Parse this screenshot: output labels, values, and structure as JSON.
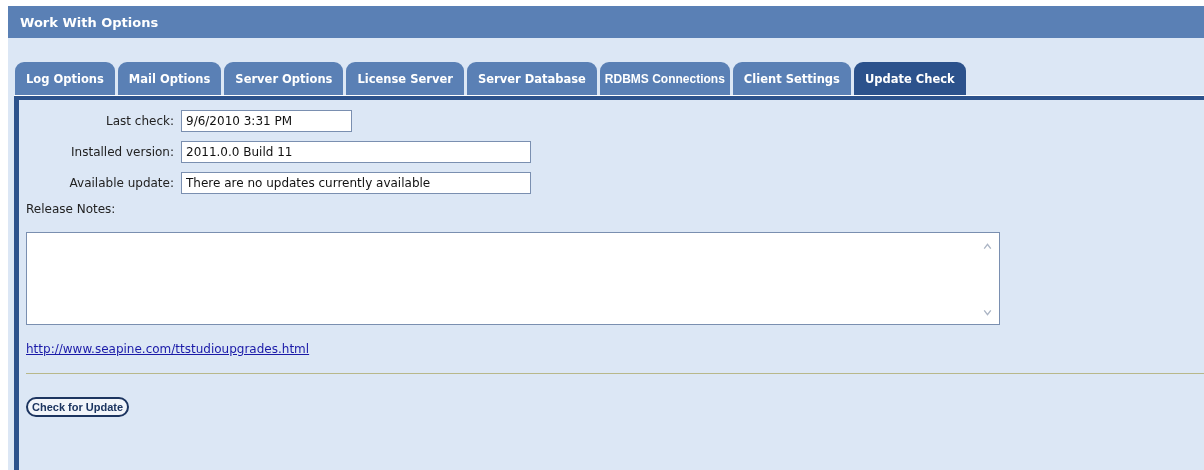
{
  "window": {
    "title": "Work With Options"
  },
  "tabs": [
    {
      "label": "Log Options",
      "selected": false
    },
    {
      "label": "Mail Options",
      "selected": false
    },
    {
      "label": "Server Options",
      "selected": false
    },
    {
      "label": "License Server",
      "selected": false
    },
    {
      "label": "Server Database",
      "selected": false
    },
    {
      "label": "RDBMS Connections",
      "selected": false,
      "kind": "condensed"
    },
    {
      "label": "Client Settings",
      "selected": false
    },
    {
      "label": "Update Check",
      "selected": true
    }
  ],
  "fields": [
    {
      "label": "Last check:",
      "value": "9/6/2010 3:31 PM",
      "kind": "short"
    },
    {
      "label": "Installed version:",
      "value": "2011.0.0 Build 11",
      "kind": "long"
    },
    {
      "label": "Available update:",
      "value": "There are no updates currently available",
      "kind": "long"
    }
  ],
  "release_notes": {
    "label": "Release Notes:"
  },
  "link": "http://www.seapine.com/ttstudioupgrades.html",
  "buttons": [
    "Check for Update"
  ]
}
